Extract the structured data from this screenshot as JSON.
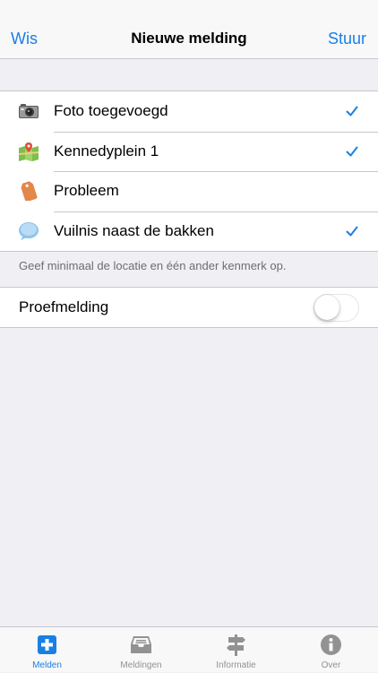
{
  "navbar": {
    "left": "Wis",
    "title": "Nieuwe melding",
    "right": "Stuur"
  },
  "items": [
    {
      "label": "Foto toegevoegd",
      "checked": true,
      "icon": "camera-icon"
    },
    {
      "label": "Kennedyplein 1",
      "checked": true,
      "icon": "map-icon"
    },
    {
      "label": "Probleem",
      "checked": false,
      "icon": "tag-icon"
    },
    {
      "label": "Vuilnis naast de bakken",
      "checked": true,
      "icon": "speech-bubble-icon"
    }
  ],
  "footer": "Geef minimaal de locatie en één ander kenmerk op.",
  "test_report": {
    "label": "Proefmelding",
    "on": false
  },
  "tabs": [
    {
      "label": "Melden",
      "icon": "plus-square-icon",
      "active": true
    },
    {
      "label": "Meldingen",
      "icon": "inbox-icon",
      "active": false
    },
    {
      "label": "Informatie",
      "icon": "signpost-icon",
      "active": false
    },
    {
      "label": "Over",
      "icon": "info-icon",
      "active": false
    }
  ],
  "colors": {
    "accent": "#1a7fe5",
    "inactive": "#929292",
    "background": "#efeff4"
  }
}
